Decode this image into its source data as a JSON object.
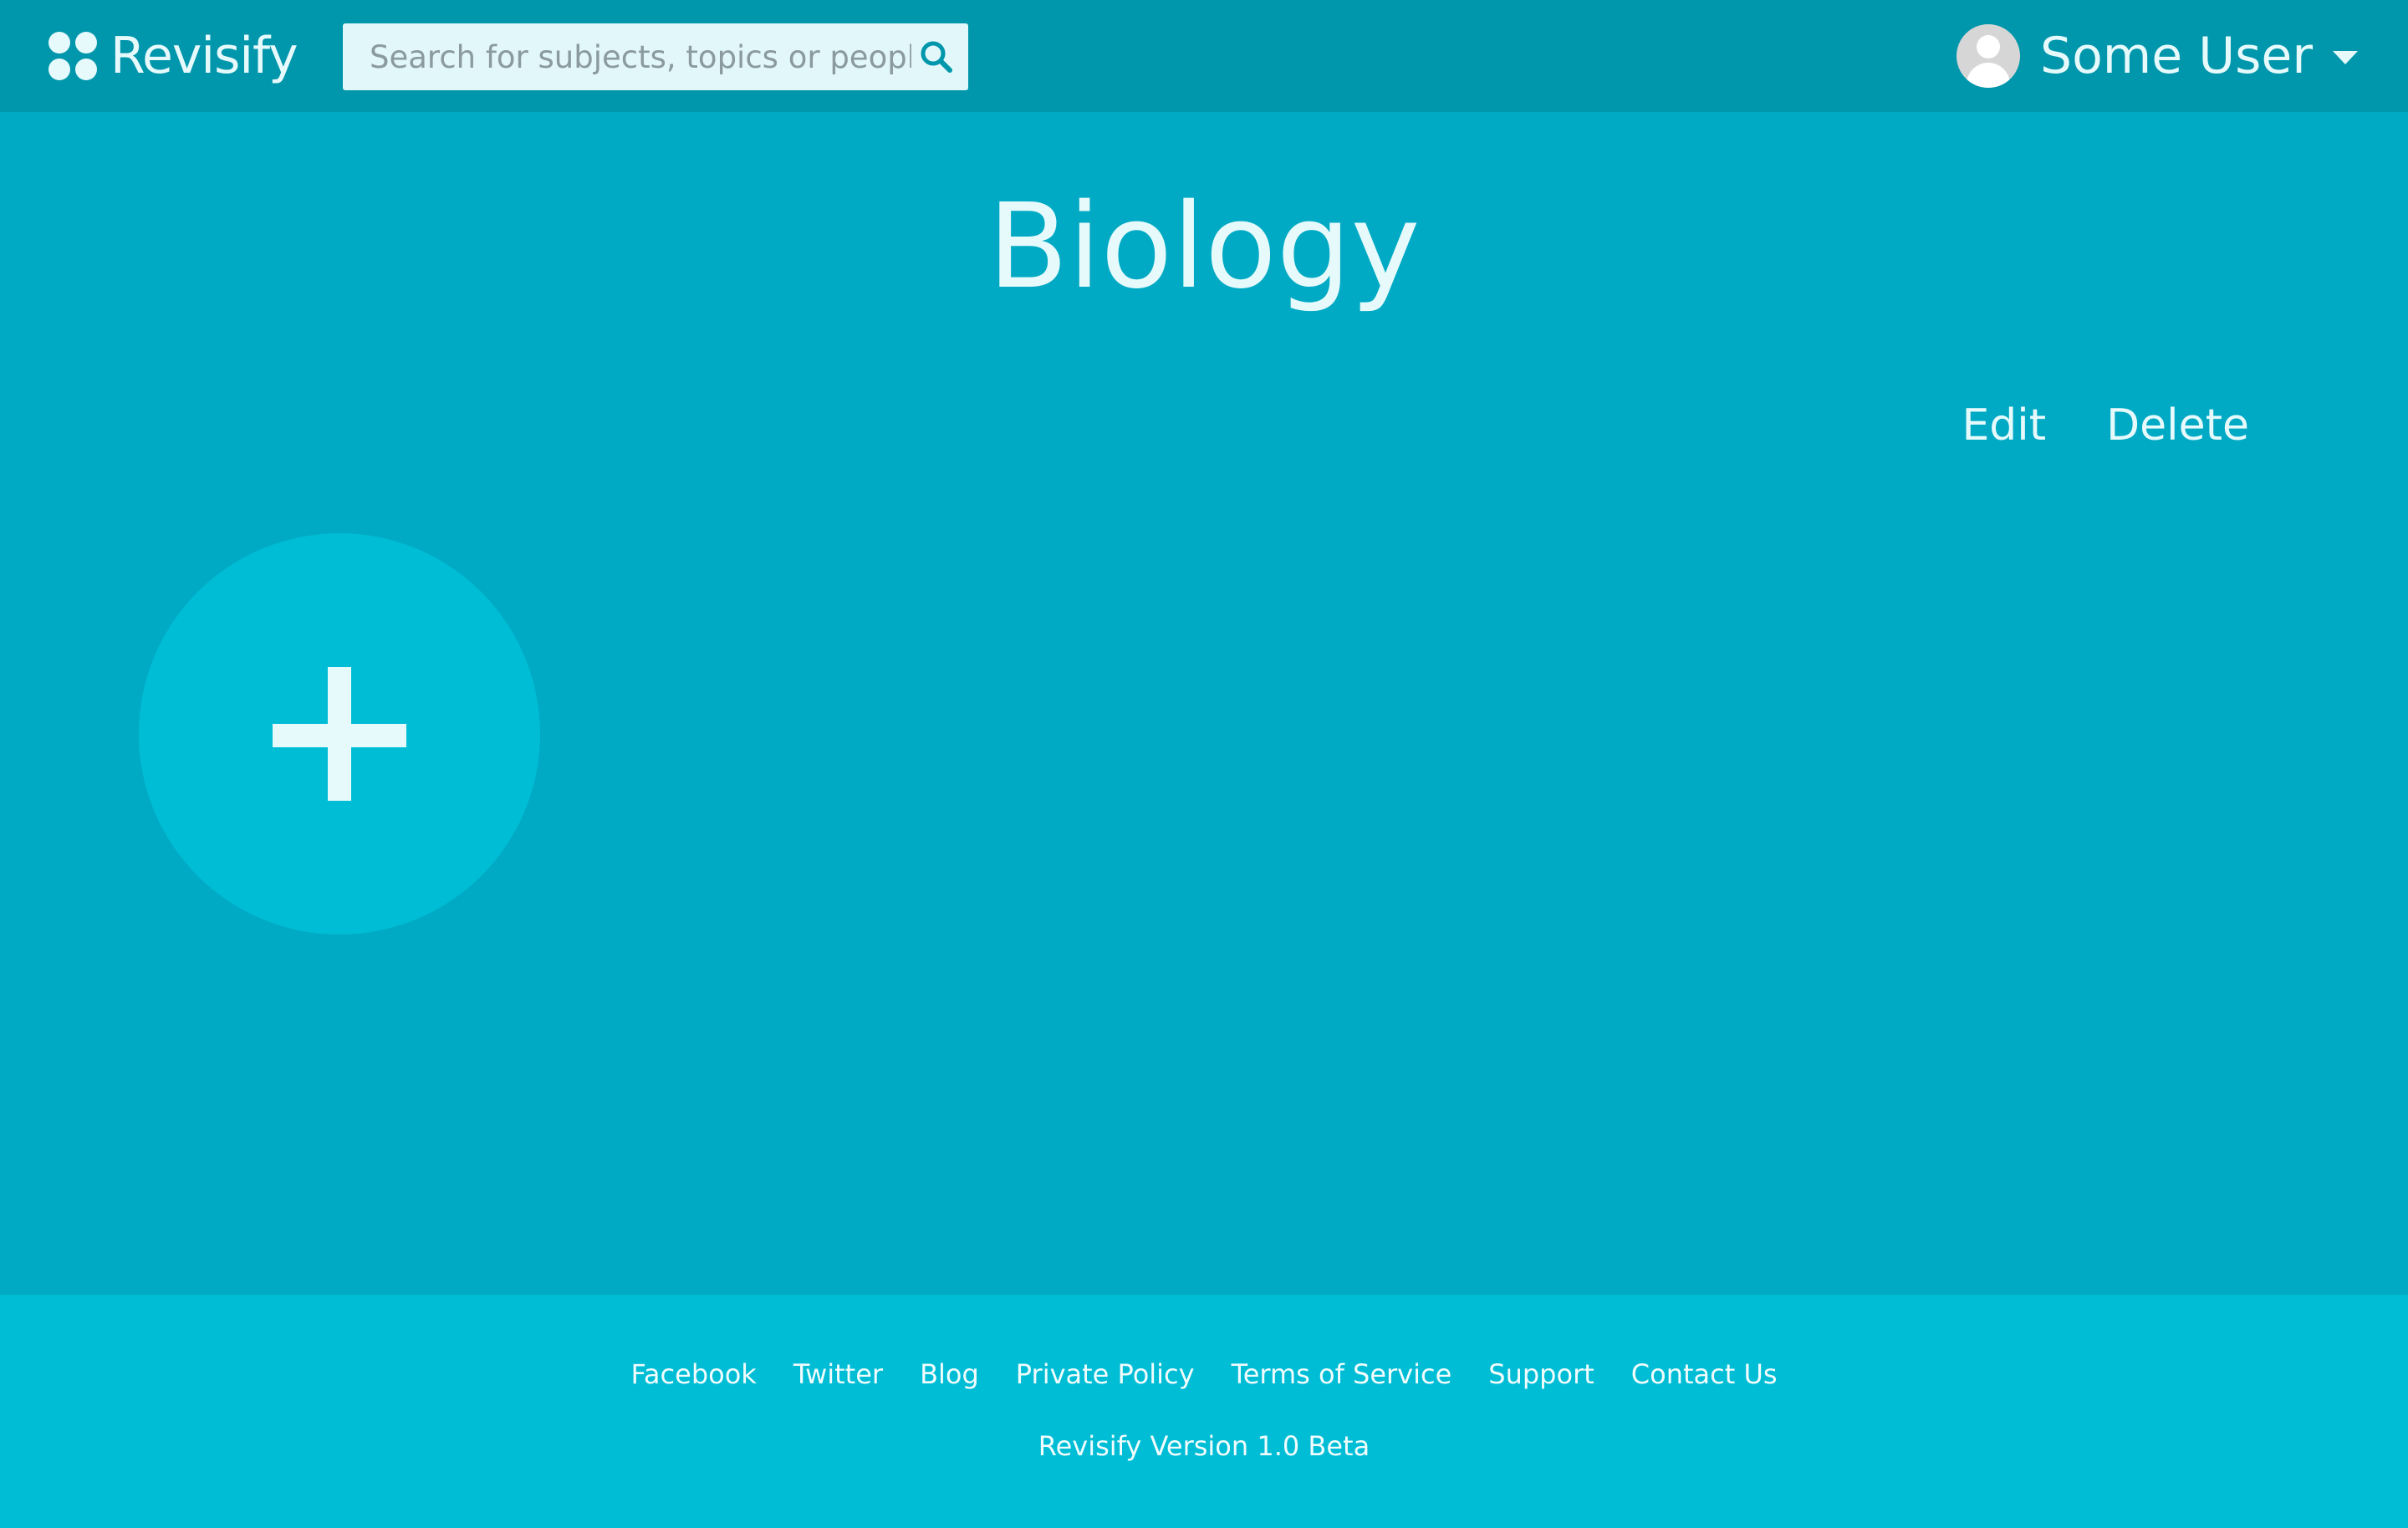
{
  "brand": {
    "name": "Revisify",
    "icon": "four-dots-logo-icon"
  },
  "search": {
    "placeholder": "Search for subjects, topics or people",
    "value": "",
    "icon": "search-icon"
  },
  "user": {
    "name": "Some User",
    "avatar_icon": "default-avatar-icon",
    "menu_icon": "caret-down-icon"
  },
  "page": {
    "title": "Biology"
  },
  "actions": {
    "edit_label": "Edit",
    "delete_label": "Delete"
  },
  "add_topic": {
    "icon": "plus-icon"
  },
  "footer": {
    "links": [
      "Facebook",
      "Twitter",
      "Blog",
      "Private Policy",
      "Terms of Service",
      "Support",
      "Contact Us"
    ],
    "version": "Revisify Version 1.0 Beta"
  },
  "colors": {
    "background": "#00aac4",
    "navbar": "#0096ab",
    "footer": "#00bdd6",
    "add_circle": "#00bdd6",
    "text": "#e6fafc"
  }
}
